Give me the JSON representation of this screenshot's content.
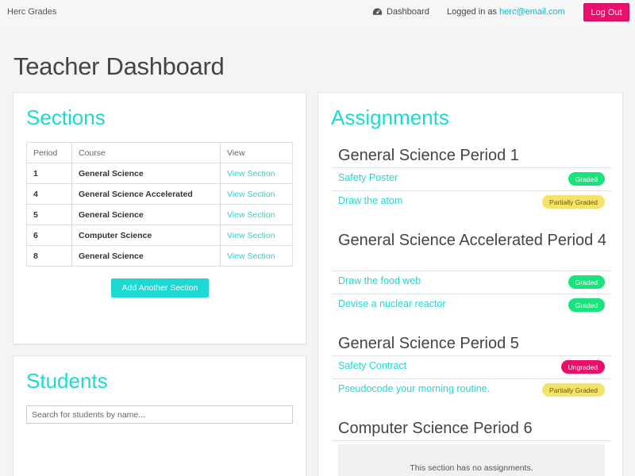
{
  "navbar": {
    "brand": "Herc Grades",
    "dashboard_label": "Dashboard",
    "dashboard_icon": "dashboard-icon",
    "logged_in_prefix": "Logged in as ",
    "email": "herc@email.com",
    "logout_label": "Log Out"
  },
  "page": {
    "title": "Teacher Dashboard"
  },
  "colors": {
    "accent": "#1ed9d1",
    "logout": "#e8106b",
    "graded": "#1ae27c",
    "partial": "#f4e26b",
    "ungraded": "#e8106b"
  },
  "sections": {
    "title": "Sections",
    "headers": [
      "Period",
      "Course",
      "View"
    ],
    "rows": [
      {
        "period": "1",
        "course": "General Science",
        "view": "View Section"
      },
      {
        "period": "4",
        "course": "General Science Accelerated",
        "view": "View Section"
      },
      {
        "period": "5",
        "course": "General Science",
        "view": "View Section"
      },
      {
        "period": "6",
        "course": "Computer Science",
        "view": "View Section"
      },
      {
        "period": "8",
        "course": "General Science",
        "view": "View Section"
      }
    ],
    "add_button": "Add Another Section"
  },
  "students": {
    "title": "Students",
    "search_placeholder": "Search for students by name..."
  },
  "assignments": {
    "title": "Assignments",
    "groups": [
      {
        "title": "General Science Period 1",
        "items": [
          {
            "name": "Safety Poster",
            "status": "Graded"
          },
          {
            "name": "Draw the atom",
            "status": "Partially Graded"
          }
        ]
      },
      {
        "title": "General Science Accelerated Period 4",
        "items": [
          {
            "name": "Draw the food web",
            "status": "Graded"
          },
          {
            "name": "Devise a nuclear reactor",
            "status": "Graded"
          }
        ]
      },
      {
        "title": "General Science Period 5",
        "items": [
          {
            "name": "Safety Contract",
            "status": "Ungraded"
          },
          {
            "name": "Pseudocode your morning routine.",
            "status": "Partially Graded"
          }
        ]
      },
      {
        "title": "Computer Science Period 6",
        "items": [],
        "empty_message": "This section has no assignments."
      }
    ]
  }
}
